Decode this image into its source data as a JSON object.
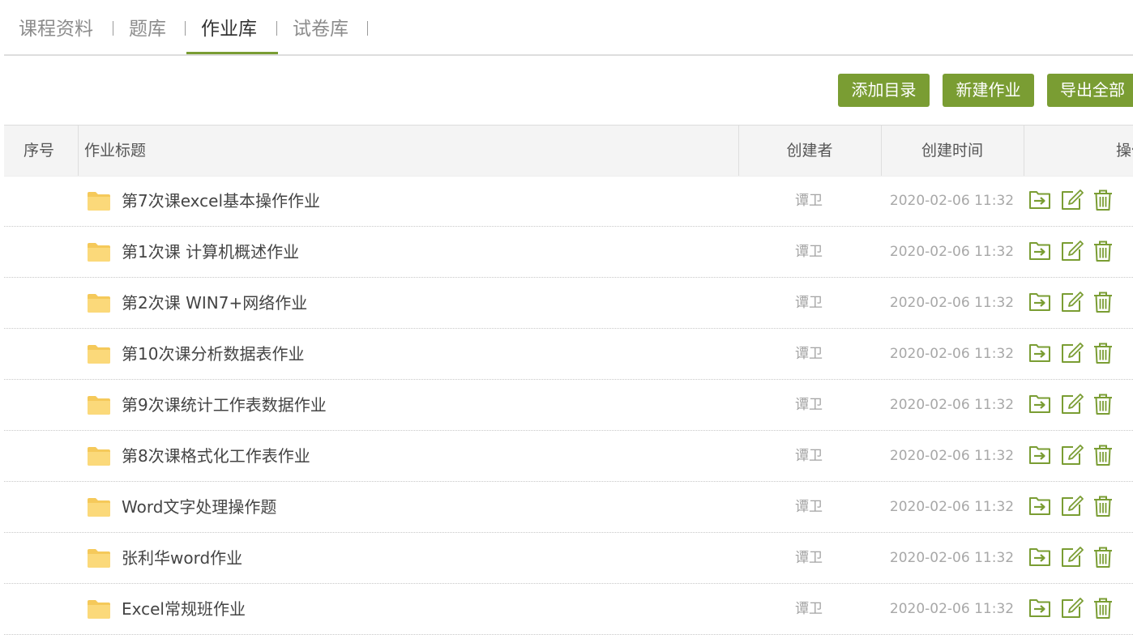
{
  "tabs": [
    {
      "label": "课程资料",
      "active": false
    },
    {
      "label": "题库",
      "active": false
    },
    {
      "label": "作业库",
      "active": true
    },
    {
      "label": "试卷库",
      "active": false
    }
  ],
  "tab_separator": "|",
  "toolbar": {
    "add_directory_label": "添加目录",
    "new_assignment_label": "新建作业",
    "export_all_label": "导出全部"
  },
  "table": {
    "headers": {
      "index": "序号",
      "title": "作业标题",
      "creator": "创建者",
      "created_time": "创建时间",
      "actions": "操作"
    },
    "rows": [
      {
        "icon": "folder-icon",
        "title": "第7次课excel基本操作作业",
        "creator": "谭卫",
        "created_time": "2020-02-06 11:32"
      },
      {
        "icon": "folder-icon",
        "title": "第1次课 计算机概述作业",
        "creator": "谭卫",
        "created_time": "2020-02-06 11:32"
      },
      {
        "icon": "folder-icon",
        "title": "第2次课 WIN7+网络作业",
        "creator": "谭卫",
        "created_time": "2020-02-06 11:32"
      },
      {
        "icon": "folder-icon",
        "title": "第10次课分析数据表作业",
        "creator": "谭卫",
        "created_time": "2020-02-06 11:32"
      },
      {
        "icon": "folder-icon",
        "title": "第9次课统计工作表数据作业",
        "creator": "谭卫",
        "created_time": "2020-02-06 11:32"
      },
      {
        "icon": "folder-icon",
        "title": "第8次课格式化工作表作业",
        "creator": "谭卫",
        "created_time": "2020-02-06 11:32"
      },
      {
        "icon": "folder-icon",
        "title": "Word文字处理操作题",
        "creator": "谭卫",
        "created_time": "2020-02-06 11:32"
      },
      {
        "icon": "folder-icon",
        "title": "张利华word作业",
        "creator": "谭卫",
        "created_time": "2020-02-06 11:32"
      },
      {
        "icon": "folder-icon",
        "title": "Excel常规班作业",
        "creator": "谭卫",
        "created_time": "2020-02-06 11:32"
      }
    ],
    "row_actions": [
      "move-to-folder-icon",
      "edit-icon",
      "delete-trash-icon"
    ]
  },
  "colors": {
    "accent": "#7a9d33",
    "folder": "#fbd97a",
    "header_bg": "#f4f4f4"
  }
}
